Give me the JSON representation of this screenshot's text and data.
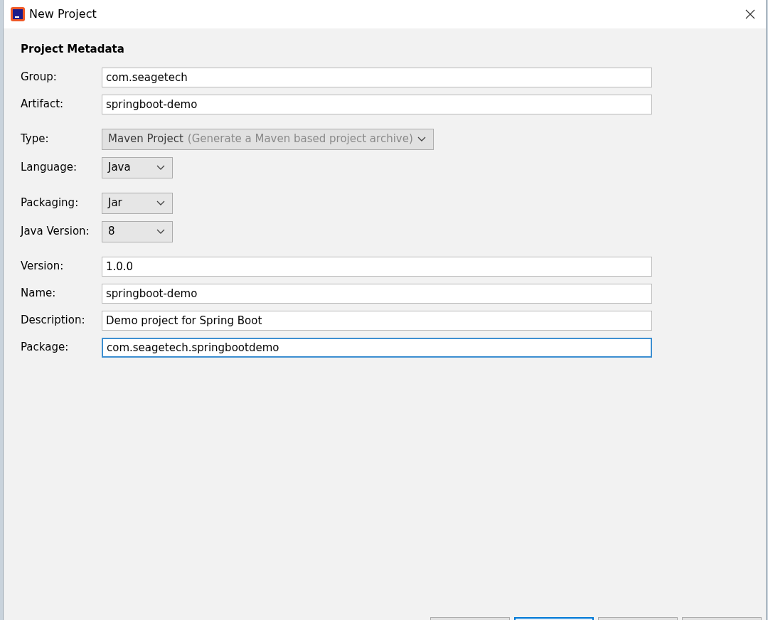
{
  "window": {
    "title": "New Project"
  },
  "heading": "Project Metadata",
  "sections": [
    {
      "fields": [
        {
          "kind": "text",
          "label": "Group:",
          "value": "com.seagetech",
          "focused": false
        },
        {
          "kind": "text",
          "label": "Artifact:",
          "value": "springboot-demo",
          "focused": false
        }
      ]
    },
    {
      "fields": [
        {
          "kind": "select",
          "label": "Type:",
          "value": "Maven Project",
          "hint": "(Generate a Maven based project archive)",
          "disabled": true
        },
        {
          "kind": "select",
          "label": "Language:",
          "value": "Java",
          "disabled": false
        }
      ]
    },
    {
      "fields": [
        {
          "kind": "select",
          "label": "Packaging:",
          "value": "Jar",
          "disabled": false
        },
        {
          "kind": "select",
          "label": "Java Version:",
          "value": "8",
          "disabled": false
        }
      ]
    },
    {
      "fields": [
        {
          "kind": "text",
          "label": "Version:",
          "value": "1.0.0",
          "focused": false
        },
        {
          "kind": "text",
          "label": "Name:",
          "value": "springboot-demo",
          "focused": false
        },
        {
          "kind": "text",
          "label": "Description:",
          "value": "Demo project for Spring Boot",
          "focused": false
        },
        {
          "kind": "text",
          "label": "Package:",
          "value": "com.seagetech.springbootdemo",
          "focused": true
        }
      ]
    }
  ],
  "buttons": [
    {
      "focused": false
    },
    {
      "focused": true
    },
    {
      "focused": false
    },
    {
      "focused": false
    }
  ]
}
